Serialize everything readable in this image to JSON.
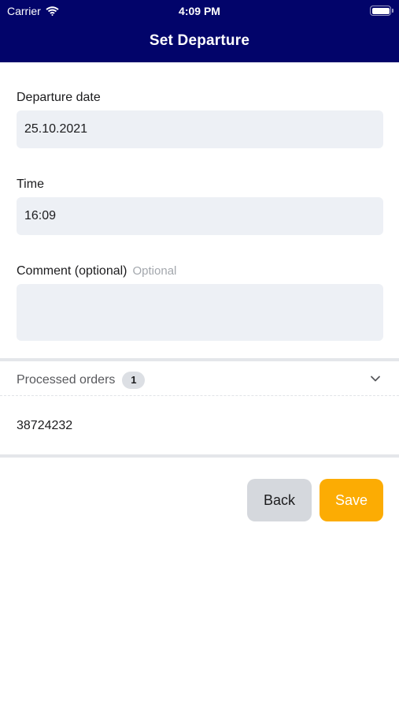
{
  "status_bar": {
    "carrier": "Carrier",
    "time": "4:09 PM"
  },
  "nav": {
    "title": "Set Departure"
  },
  "form": {
    "departure_date": {
      "label": "Departure date",
      "value": "25.10.2021"
    },
    "time": {
      "label": "Time",
      "value": "16:09"
    },
    "comment": {
      "label": "Comment (optional)",
      "hint": "Optional",
      "value": ""
    }
  },
  "processed_orders": {
    "label": "Processed orders",
    "count": "1",
    "items": [
      "38724232"
    ]
  },
  "actions": {
    "back_label": "Back",
    "save_label": "Save"
  },
  "colors": {
    "header_bg": "#02046a",
    "field_bg": "#edf0f5",
    "save_button": "#fcac03",
    "back_button": "#d5d8dd"
  },
  "icons": {
    "wifi": "wifi-icon",
    "battery": "battery-icon",
    "chevron": "chevron-down-icon"
  }
}
